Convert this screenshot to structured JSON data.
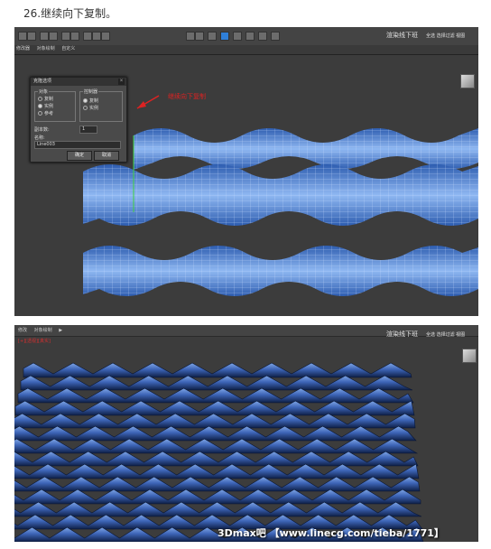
{
  "step_caption": "26.继续向下复制。",
  "shot1": {
    "brand": "渲染线下班",
    "toolbar_right": "全选 选择过滤 视图",
    "tabs": [
      "修改器",
      "对象绘制",
      "自定义"
    ],
    "dialog": {
      "title": "克隆选项",
      "object_group": "对象",
      "object_options": [
        "复制",
        "实例",
        "参考"
      ],
      "controller_group": "控制器",
      "controller_options": [
        "复制",
        "实例"
      ],
      "copies_label": "副本数:",
      "copies_value": "1",
      "name_label": "名称:",
      "name_value": "Line003",
      "ok": "确定",
      "cancel": "取消"
    },
    "annotation": "继续向下复制"
  },
  "shot2": {
    "brand": "渲染线下班",
    "toolbar_right": "全选 选择过滤 视图",
    "tabs": [
      "修改",
      "对象绘制",
      "▶"
    ],
    "red_label": "[+][透视][真实]",
    "watermark": "3Dmax吧 【www.linecg.com/tieba/1771】"
  }
}
